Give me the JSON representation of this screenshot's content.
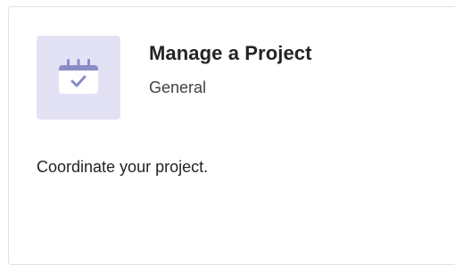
{
  "card": {
    "title": "Manage a Project",
    "category": "General",
    "description": "Coordinate your project.",
    "icon": "calendar-check-icon",
    "colors": {
      "icon_tile_bg": "#e3e2f5",
      "icon_accent": "#8b8cc7"
    }
  }
}
